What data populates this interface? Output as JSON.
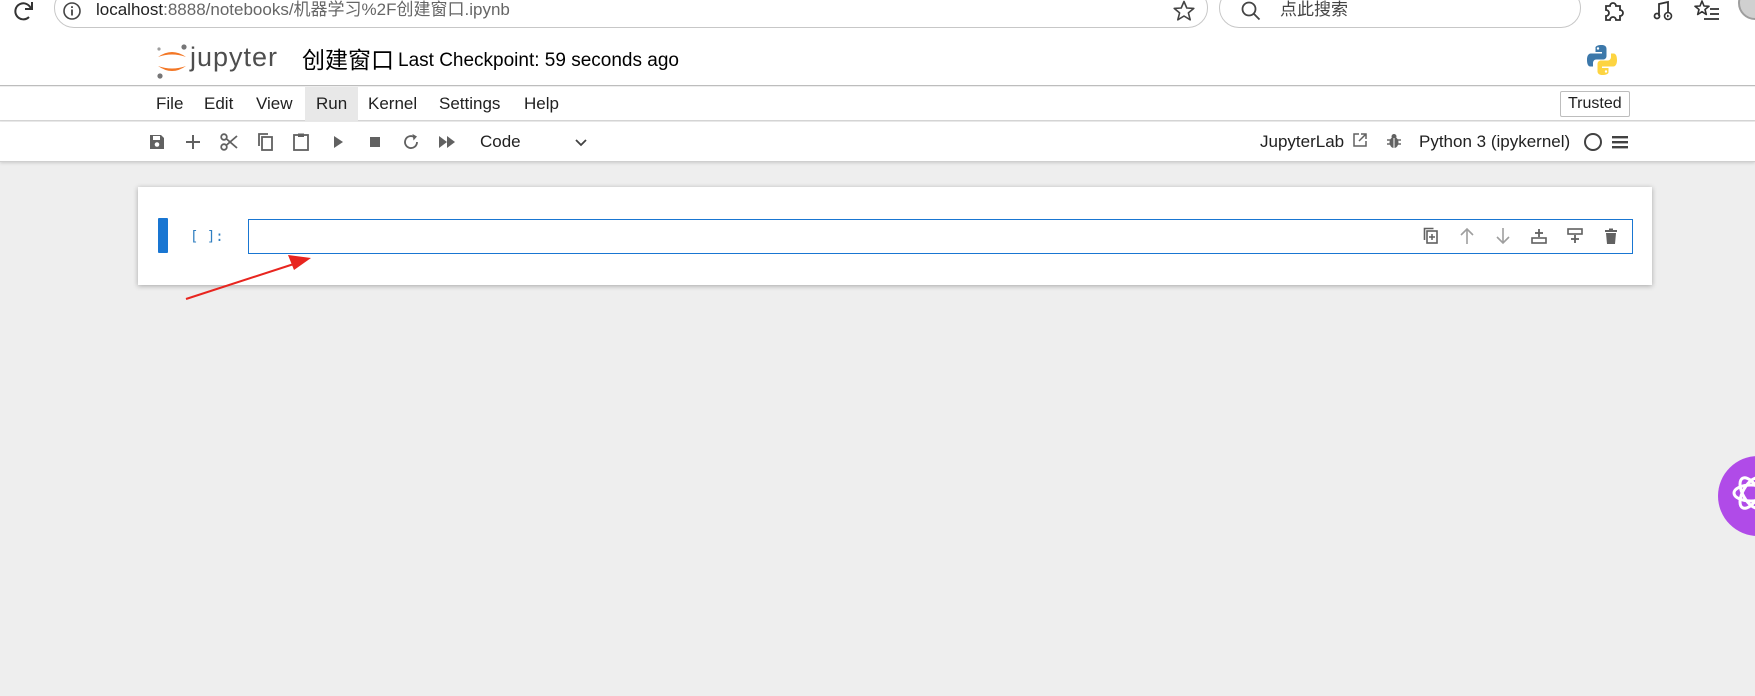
{
  "browser": {
    "url_host": "localhost",
    "url_rest": ":8888/notebooks/机器学习%2F创建窗口.ipynb",
    "search_placeholder": "点此搜索"
  },
  "header": {
    "logo_text": "jupyter",
    "notebook_title": "创建窗口",
    "checkpoint": "Last Checkpoint: 59 seconds ago"
  },
  "menu": {
    "items": [
      "File",
      "Edit",
      "View",
      "Run",
      "Kernel",
      "Settings",
      "Help"
    ],
    "active": "Run",
    "trusted_label": "Trusted"
  },
  "toolbar": {
    "cell_type": "Code",
    "jupyterlab_label": "JupyterLab",
    "kernel_name": "Python 3 (ipykernel)"
  },
  "cell": {
    "prompt": "[ ]:",
    "source": ""
  },
  "colors": {
    "accent": "#1976d2",
    "prompt": "#307fc1",
    "annotation_arrow": "#e8251f",
    "orb": "#b04be8"
  },
  "icons": {
    "toolbar": [
      "save-icon",
      "add-icon",
      "cut-icon",
      "copy-icon",
      "paste-icon",
      "run-icon",
      "stop-icon",
      "restart-icon",
      "run-all-icon"
    ],
    "cell_tools": [
      "duplicate-icon",
      "move-up-icon",
      "move-down-icon",
      "insert-above-icon",
      "insert-below-icon",
      "delete-icon"
    ]
  }
}
